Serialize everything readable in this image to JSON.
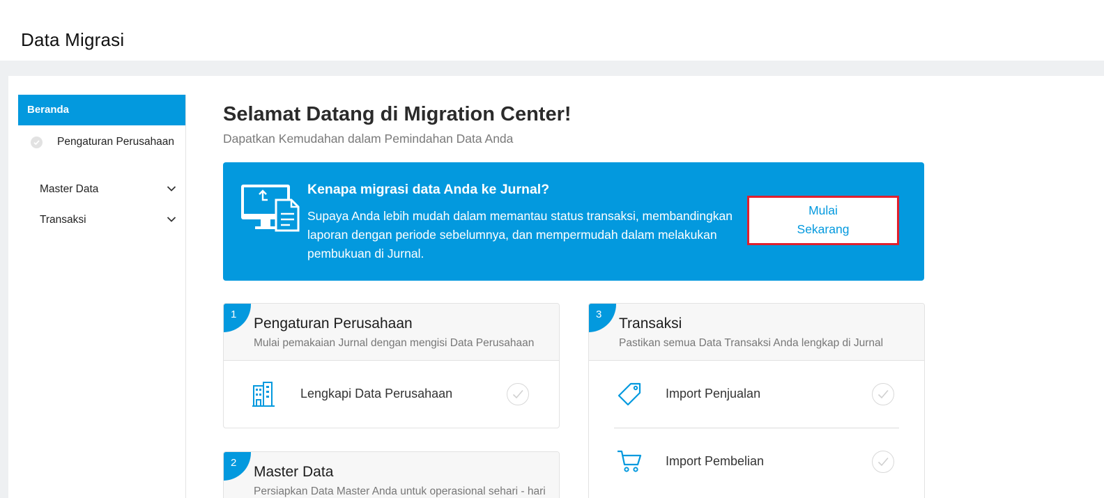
{
  "header": {
    "title": "Data Migrasi"
  },
  "sidebar": {
    "active": "Beranda",
    "sub_item": "Pengaturan Perusahaan",
    "items": [
      {
        "label": "Master Data"
      },
      {
        "label": "Transaksi"
      }
    ]
  },
  "main": {
    "title": "Selamat Datang di Migration Center!",
    "subtitle": "Dapatkan Kemudahan dalam Pemindahan Data Anda",
    "banner": {
      "heading": "Kenapa migrasi data Anda ke Jurnal?",
      "text": "Supaya Anda lebih mudah dalam memantau status transaksi, membandingkan laporan dengan periode sebelumnya, dan mempermudah dalam melakukan pembukuan di Jurnal.",
      "cta_line1": "Mulai",
      "cta_line2": "Sekarang"
    },
    "steps": [
      {
        "number": "1",
        "title": "Pengaturan Perusahaan",
        "subtitle": "Mulai pemakaian Jurnal dengan mengisi Data Perusahaan",
        "tasks": [
          {
            "label": "Lengkapi Data Perusahaan",
            "icon": "building-icon"
          }
        ]
      },
      {
        "number": "2",
        "title": "Master Data",
        "subtitle": "Persiapkan Data Master Anda untuk operasional sehari - hari"
      },
      {
        "number": "3",
        "title": "Transaksi",
        "subtitle": "Pastikan semua Data Transaksi Anda lengkap di Jurnal",
        "tasks": [
          {
            "label": "Import Penjualan",
            "icon": "tag-icon"
          },
          {
            "label": "Import Pembelian",
            "icon": "cart-icon"
          }
        ]
      }
    ]
  },
  "colors": {
    "accent": "#0399de",
    "highlight": "#e0202e",
    "background": "#eef0f2"
  }
}
